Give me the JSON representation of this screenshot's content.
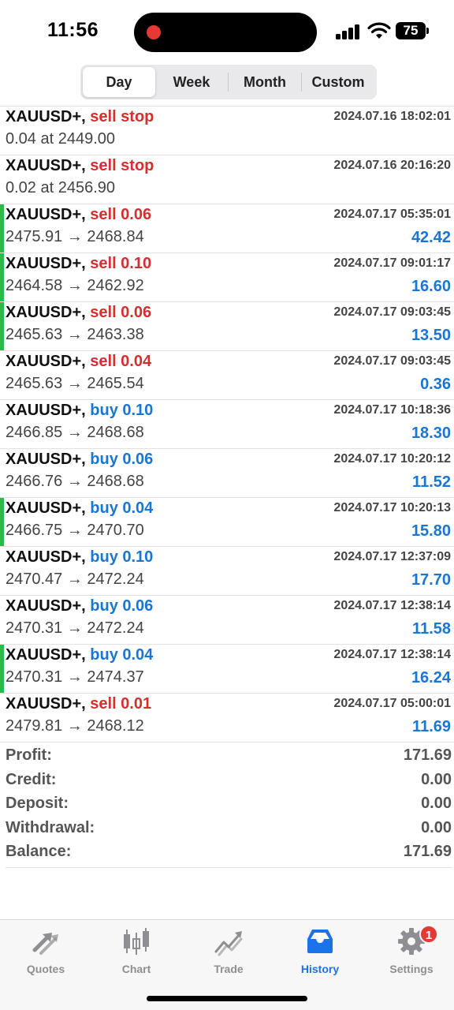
{
  "status": {
    "time": "11:56",
    "battery": "75"
  },
  "periods": [
    {
      "label": "Day",
      "active": true
    },
    {
      "label": "Week",
      "active": false
    },
    {
      "label": "Month",
      "active": false
    },
    {
      "label": "Custom",
      "active": false
    }
  ],
  "orders": [
    {
      "symbol": "XAUUSD+,",
      "side": "sell stop",
      "type": "sell",
      "time": "2024.07.16 18:02:01",
      "detail": "0.04 at 2449.00",
      "profit": "",
      "marked": false
    },
    {
      "symbol": "XAUUSD+,",
      "side": "sell stop",
      "type": "sell",
      "time": "2024.07.16 20:16:20",
      "detail": "0.02 at 2456.90",
      "profit": "",
      "marked": false
    },
    {
      "symbol": "XAUUSD+,",
      "side": "sell 0.06",
      "type": "sell",
      "time": "2024.07.17 05:35:01",
      "detail": "2475.91 → 2468.84",
      "profit": "42.42",
      "marked": true
    },
    {
      "symbol": "XAUUSD+,",
      "side": "sell 0.10",
      "type": "sell",
      "time": "2024.07.17 09:01:17",
      "detail": "2464.58 → 2462.92",
      "profit": "16.60",
      "marked": true
    },
    {
      "symbol": "XAUUSD+,",
      "side": "sell 0.06",
      "type": "sell",
      "time": "2024.07.17 09:03:45",
      "detail": "2465.63 → 2463.38",
      "profit": "13.50",
      "marked": true
    },
    {
      "symbol": "XAUUSD+,",
      "side": "sell 0.04",
      "type": "sell",
      "time": "2024.07.17 09:03:45",
      "detail": "2465.63 → 2465.54",
      "profit": "0.36",
      "marked": false
    },
    {
      "symbol": "XAUUSD+,",
      "side": "buy 0.10",
      "type": "buy",
      "time": "2024.07.17 10:18:36",
      "detail": "2466.85 → 2468.68",
      "profit": "18.30",
      "marked": false
    },
    {
      "symbol": "XAUUSD+,",
      "side": "buy 0.06",
      "type": "buy",
      "time": "2024.07.17 10:20:12",
      "detail": "2466.76 → 2468.68",
      "profit": "11.52",
      "marked": false
    },
    {
      "symbol": "XAUUSD+,",
      "side": "buy 0.04",
      "type": "buy",
      "time": "2024.07.17 10:20:13",
      "detail": "2466.75 → 2470.70",
      "profit": "15.80",
      "marked": true
    },
    {
      "symbol": "XAUUSD+,",
      "side": "buy 0.10",
      "type": "buy",
      "time": "2024.07.17 12:37:09",
      "detail": "2470.47 → 2472.24",
      "profit": "17.70",
      "marked": false
    },
    {
      "symbol": "XAUUSD+,",
      "side": "buy 0.06",
      "type": "buy",
      "time": "2024.07.17 12:38:14",
      "detail": "2470.31 → 2472.24",
      "profit": "11.58",
      "marked": false
    },
    {
      "symbol": "XAUUSD+,",
      "side": "buy 0.04",
      "type": "buy",
      "time": "2024.07.17 12:38:14",
      "detail": "2470.31 → 2474.37",
      "profit": "16.24",
      "marked": true
    },
    {
      "symbol": "XAUUSD+,",
      "side": "sell 0.01",
      "type": "sell",
      "time": "2024.07.17 05:00:01",
      "detail": "2479.81 → 2468.12",
      "profit": "11.69",
      "marked": false
    }
  ],
  "summary": [
    {
      "label": "Profit:",
      "value": "171.69"
    },
    {
      "label": "Credit:",
      "value": "0.00"
    },
    {
      "label": "Deposit:",
      "value": "0.00"
    },
    {
      "label": "Withdrawal:",
      "value": "0.00"
    },
    {
      "label": "Balance:",
      "value": "171.69"
    }
  ],
  "tabs": [
    {
      "label": "Quotes",
      "icon": "quotes-arrows-icon",
      "active": false
    },
    {
      "label": "Chart",
      "icon": "candlestick-chart-icon",
      "active": false
    },
    {
      "label": "Trade",
      "icon": "trade-trend-icon",
      "active": false
    },
    {
      "label": "History",
      "icon": "history-inbox-icon",
      "active": true
    },
    {
      "label": "Settings",
      "icon": "gear-icon",
      "active": false,
      "badge": "1"
    }
  ],
  "colors": {
    "sell": "#d32f2f",
    "buy": "#1976d2",
    "profit": "#1976d2",
    "marker": "#2db84c",
    "active_tab": "#1a73e8"
  }
}
